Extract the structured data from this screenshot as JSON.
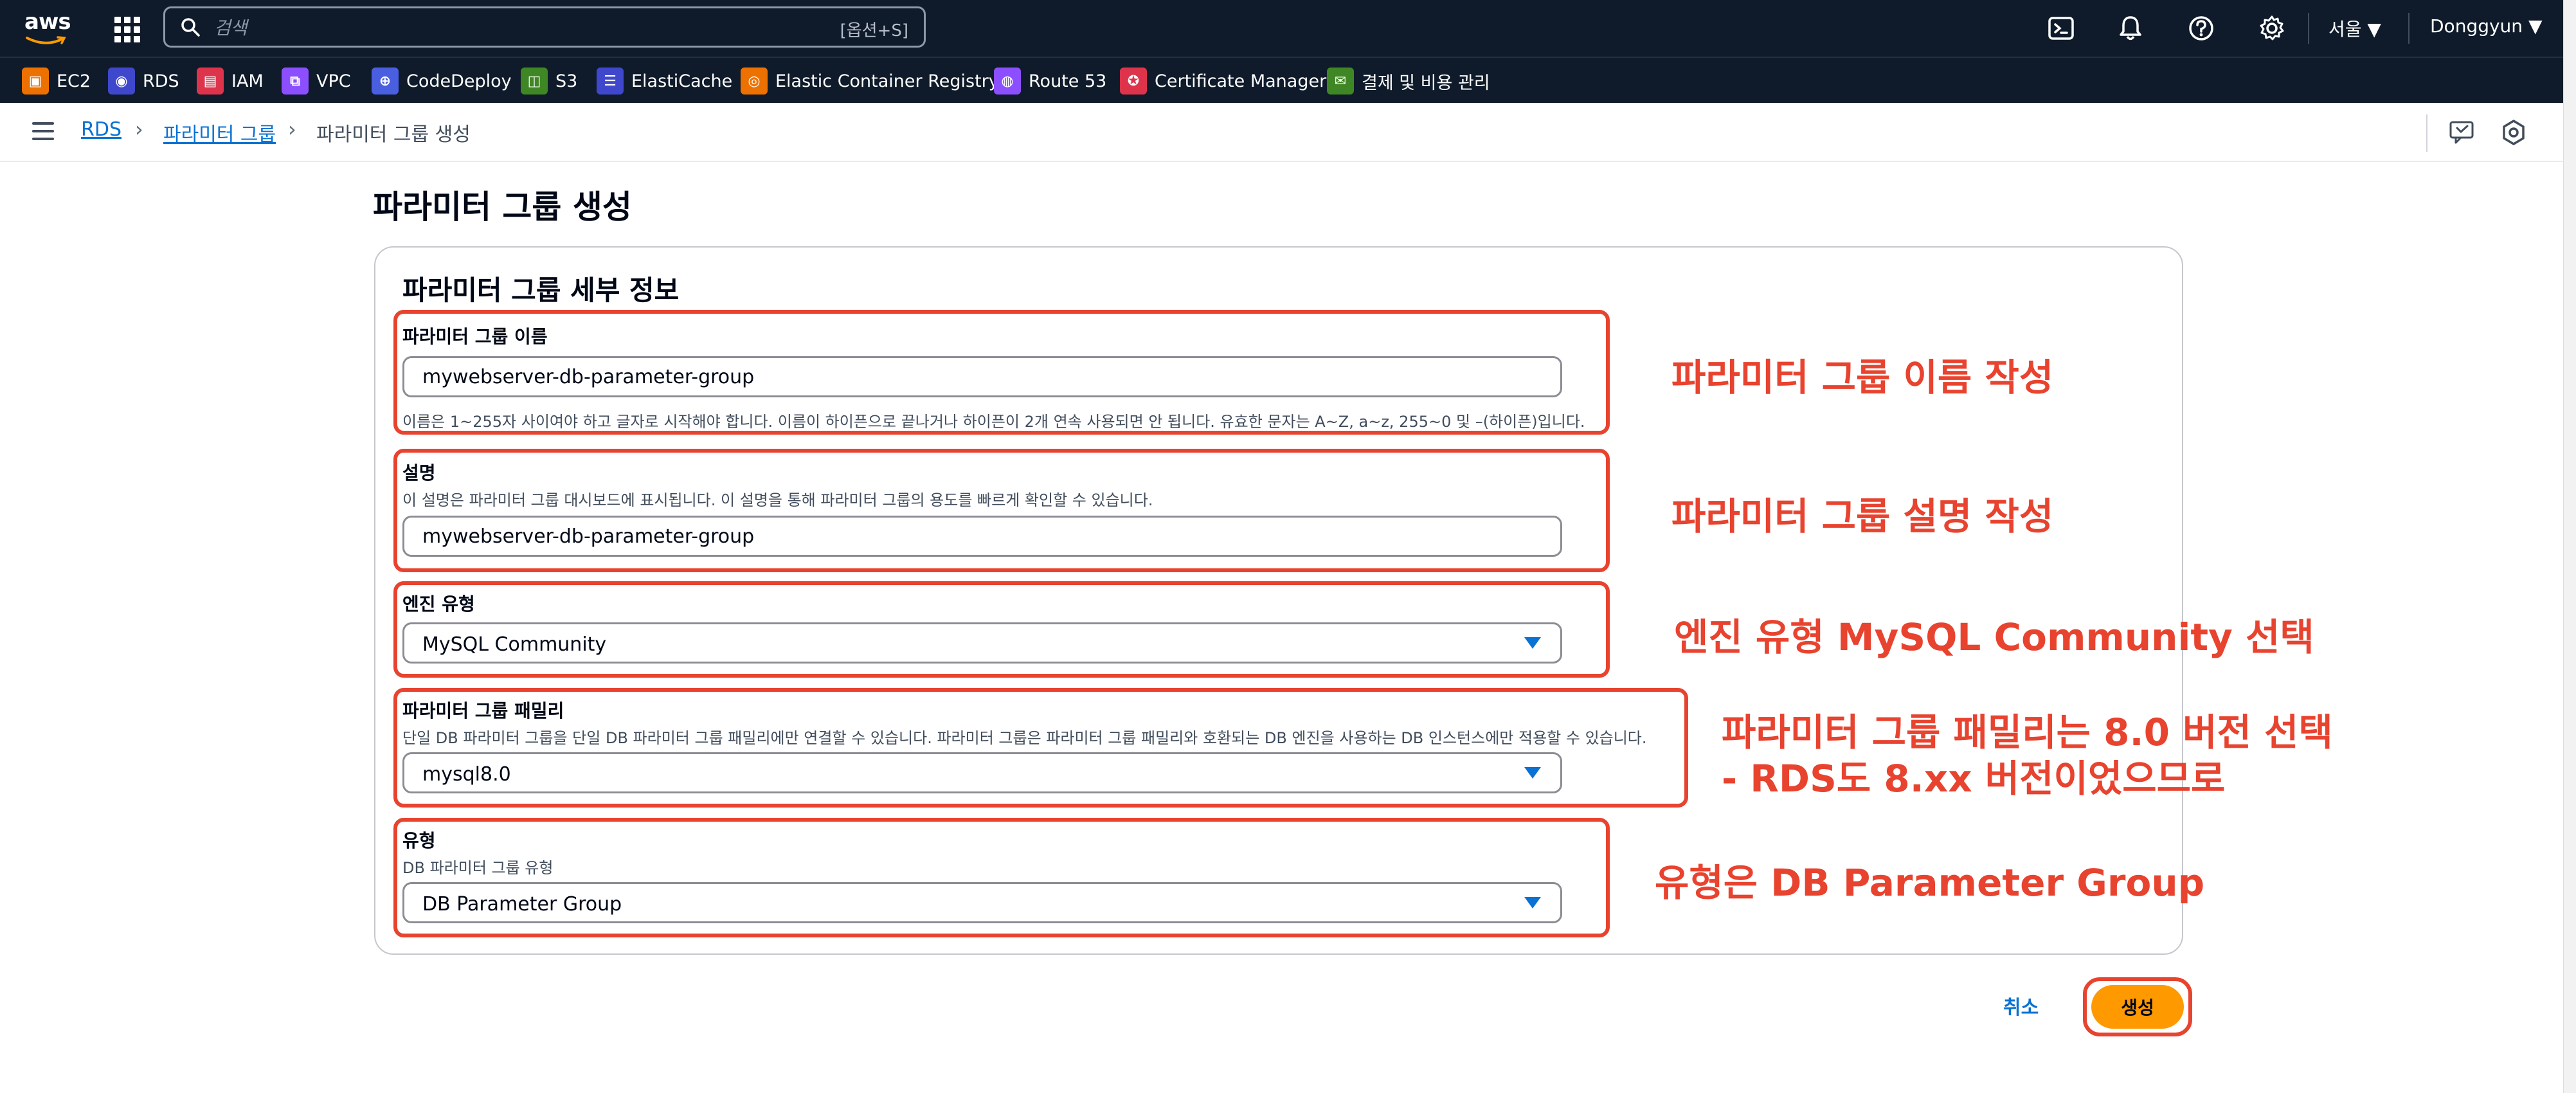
{
  "topnav": {
    "logo_text": "aws",
    "search_placeholder": "검색",
    "search_shortcut": "[옵션+S]",
    "region": "서울 ▼",
    "user": "Donggyun ▼"
  },
  "favorites": [
    {
      "label": "EC2",
      "icon": "ec2-icon",
      "color": "#ed7100"
    },
    {
      "label": "RDS",
      "icon": "rds-icon",
      "color": "#3f48cc"
    },
    {
      "label": "IAM",
      "icon": "iam-icon",
      "color": "#dd344c"
    },
    {
      "label": "VPC",
      "icon": "vpc-icon",
      "color": "#8c4fff"
    },
    {
      "label": "CodeDeploy",
      "icon": "codedeploy-icon",
      "color": "#4a5fe0"
    },
    {
      "label": "S3",
      "icon": "s3-icon",
      "color": "#3f8624"
    },
    {
      "label": "ElastiCache",
      "icon": "elasticache-icon",
      "color": "#3f48cc"
    },
    {
      "label": "Elastic Container Registry",
      "icon": "ecr-icon",
      "color": "#ed7100"
    },
    {
      "label": "Route 53",
      "icon": "route53-icon",
      "color": "#8c4fff"
    },
    {
      "label": "Certificate Manager",
      "icon": "certificate-manager-icon",
      "color": "#dd344c"
    },
    {
      "label": "결제 및 비용 관리",
      "icon": "billing-icon",
      "color": "#3f8624"
    }
  ],
  "breadcrumb": {
    "items": [
      "RDS",
      "파라미터 그룹"
    ],
    "current": "파라미터 그룹 생성"
  },
  "page": {
    "title": "파라미터 그룹 생성",
    "panel_title": "파라미터 그룹 세부 정보"
  },
  "form": {
    "name": {
      "label": "파라미터 그룹 이름",
      "value": "mywebserver-db-parameter-group",
      "hint": "이름은 1~255자 사이여야 하고 글자로 시작해야 합니다. 이름이 하이픈으로 끝나거나 하이픈이 2개 연속 사용되면 안 됩니다. 유효한 문자는 A~Z, a~z, 255~0 및 –(하이픈)입니다."
    },
    "description": {
      "label": "설명",
      "hint": "이 설명은 파라미터 그룹 대시보드에 표시됩니다. 이 설명을 통해 파라미터 그룹의 용도를 빠르게 확인할 수 있습니다.",
      "value": "mywebserver-db-parameter-group"
    },
    "engine": {
      "label": "엔진 유형",
      "value": "MySQL Community"
    },
    "family": {
      "label": "파라미터 그룹 패밀리",
      "hint": "단일 DB 파라미터 그룹을 단일 DB 파라미터 그룹 패밀리에만 연결할 수 있습니다. 파라미터 그룹은 파라미터 그룹 패밀리와 호환되는 DB 엔진을 사용하는 DB 인스턴스에만 적용할 수 있습니다.",
      "value": "mysql8.0"
    },
    "type": {
      "label": "유형",
      "hint": "DB 파라미터 그룹 유형",
      "value": "DB Parameter Group"
    }
  },
  "annotations": {
    "name_note": "파라미터 그룹 이름 작성",
    "desc_note": "파라미터 그룹 설명 작성",
    "engine_note": "엔진 유형 MySQL Community 선택",
    "family_note_1": "파라미터 그룹 패밀리는 8.0 버전 선택",
    "family_note_2": "- RDS도 8.xx 버전이었으므로",
    "type_note": "유형은 DB Parameter Group",
    "color": "#e8432f"
  },
  "actions": {
    "cancel": "취소",
    "create": "생성"
  }
}
